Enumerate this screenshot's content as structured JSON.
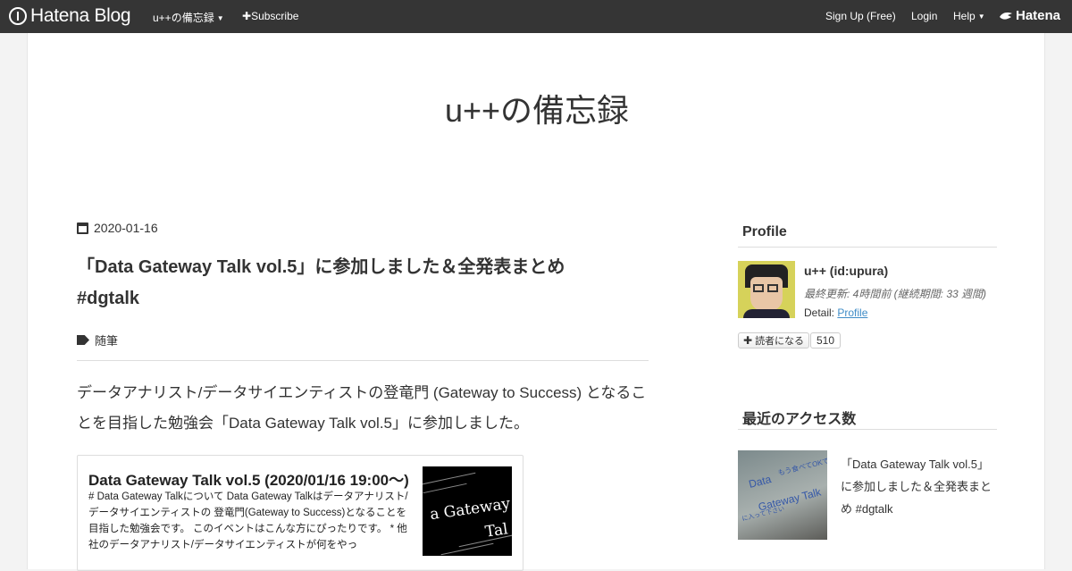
{
  "topbar": {
    "logo_text": "Hatena Blog",
    "blog_menu": "u++の備忘録",
    "subscribe": "Subscribe",
    "signup": "Sign Up (Free)",
    "login": "Login",
    "help": "Help",
    "hatena": "Hatena"
  },
  "blog": {
    "title": "u++の備忘録"
  },
  "entry": {
    "date": "2020-01-16",
    "title": "「Data Gateway Talk vol.5」に参加しました＆全発表まとめ #dgtalk",
    "category": "随筆",
    "body": "データアナリスト/データサイエンティストの登竜門 (Gateway to Success) となることを目指した勉強会「Data Gateway Talk vol.5」に参加しました。",
    "embed": {
      "title": "Data Gateway Talk vol.5 (2020/01/16 19:00〜)",
      "description": "# Data Gateway Talkについて Data Gateway Talkはデータアナリスト/データサイエンティストの 登竜門(Gateway to Success)となることを目指した勉強会です。 このイベントはこんな方にぴったりです。 * 他社のデータアナリスト/データサイエンティストが何をやっ",
      "thumb_line1": "a Gateway",
      "thumb_line2": "Tal"
    }
  },
  "sidebar": {
    "profile_heading": "Profile",
    "profile_name": "u++ (id:upura)",
    "profile_updated": "最終更新: 4時間前 (継続期間: 33 週間)",
    "detail_label": "Detail:",
    "detail_link": "Profile",
    "subscribe_button": "読者になる",
    "subscriber_count": "510",
    "access_heading": "最近のアクセス数",
    "access_item": {
      "title": "「Data Gateway Talk vol.5」に参加しました＆全発表まとめ #dgtalk",
      "thumb_line0": "もう食べてOKです",
      "thumb_line1": "Data",
      "thumb_line2": "Gateway Talk",
      "thumb_line3": "に入って下さい"
    }
  }
}
